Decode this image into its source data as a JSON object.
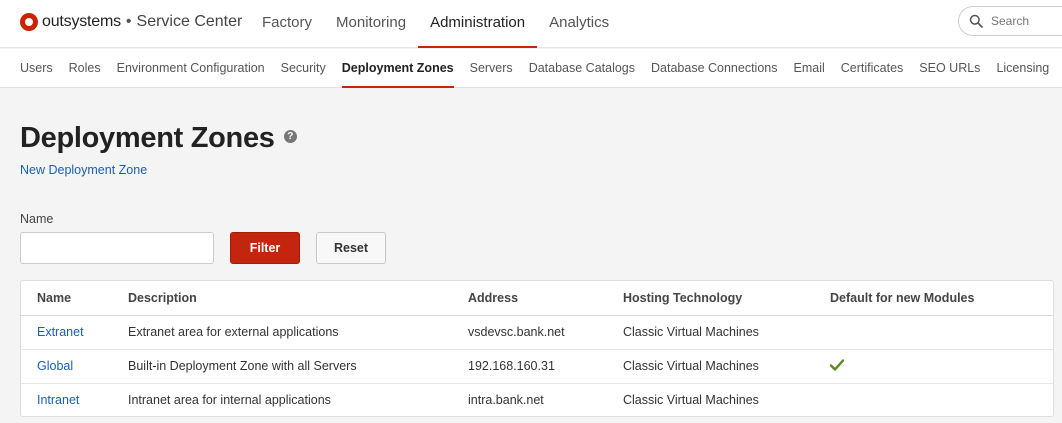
{
  "header": {
    "brand": "outsystems",
    "separator": "•",
    "product": "Service Center",
    "nav": [
      {
        "label": "Factory",
        "active": false
      },
      {
        "label": "Monitoring",
        "active": false
      },
      {
        "label": "Administration",
        "active": true
      },
      {
        "label": "Analytics",
        "active": false
      }
    ],
    "search": {
      "placeholder": "Search",
      "value": ""
    }
  },
  "subnav": [
    {
      "label": "Users",
      "active": false
    },
    {
      "label": "Roles",
      "active": false
    },
    {
      "label": "Environment Configuration",
      "active": false
    },
    {
      "label": "Security",
      "active": false
    },
    {
      "label": "Deployment Zones",
      "active": true
    },
    {
      "label": "Servers",
      "active": false
    },
    {
      "label": "Database Catalogs",
      "active": false
    },
    {
      "label": "Database Connections",
      "active": false
    },
    {
      "label": "Email",
      "active": false
    },
    {
      "label": "Certificates",
      "active": false
    },
    {
      "label": "SEO URLs",
      "active": false
    },
    {
      "label": "Licensing",
      "active": false
    }
  ],
  "page": {
    "title": "Deployment Zones",
    "help_icon": "?",
    "new_link": "New Deployment Zone"
  },
  "filter": {
    "name_label": "Name",
    "name_value": "",
    "filter_button": "Filter",
    "reset_button": "Reset"
  },
  "table": {
    "columns": [
      "Name",
      "Description",
      "Address",
      "Hosting Technology",
      "Default for new Modules"
    ],
    "rows": [
      {
        "name": "Extranet",
        "description": "Extranet area for external applications",
        "address": "vsdevsc.bank.net",
        "hosting": "Classic Virtual Machines",
        "default": false
      },
      {
        "name": "Global",
        "description": "Built-in Deployment Zone with all Servers",
        "address": "192.168.160.31",
        "hosting": "Classic Virtual Machines",
        "default": true
      },
      {
        "name": "Intranet",
        "description": "Intranet area for internal applications",
        "address": "intra.bank.net",
        "hosting": "Classic Virtual Machines",
        "default": false
      }
    ]
  },
  "colors": {
    "accent": "#cc2200",
    "link": "#1a5fb4",
    "check": "#5a8a1e"
  },
  "icons": {
    "logo": "outsystems-logo-icon",
    "help": "help-icon",
    "search": "search-icon",
    "default": "checkmark-icon"
  }
}
